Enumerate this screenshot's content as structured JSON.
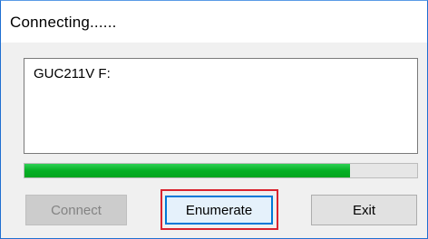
{
  "window": {
    "title": "Connecting......"
  },
  "output": {
    "text": "GUC211V F:"
  },
  "progress": {
    "fraction": 0.83,
    "color": "#06b025"
  },
  "buttons": {
    "connect_label": "Connect",
    "enumerate_label": "Enumerate",
    "exit_label": "Exit"
  },
  "colors": {
    "window_border": "#1f6fd1",
    "focus_border": "#0078d7",
    "highlight": "#d9232e"
  }
}
